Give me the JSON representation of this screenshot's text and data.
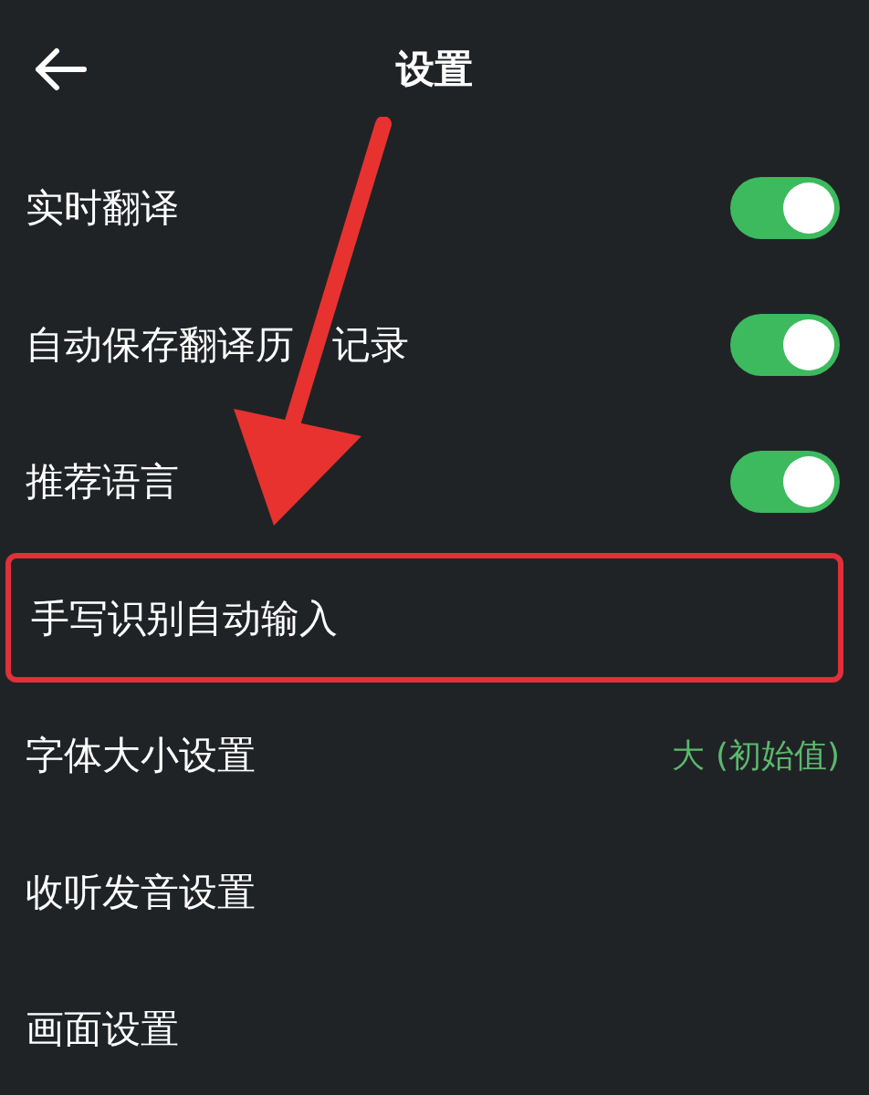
{
  "header": {
    "title": "设置"
  },
  "rows": [
    {
      "kind": "toggle",
      "label": "实时翻译",
      "on": true
    },
    {
      "kind": "toggle",
      "label": "自动保存翻译历",
      "label_2": "记录",
      "on": true
    },
    {
      "kind": "toggle",
      "label": "推荐语言",
      "on": true
    },
    {
      "kind": "plain",
      "label": "手写识别自动输入",
      "highlighted": true
    },
    {
      "kind": "value",
      "label": "字体大小设置",
      "value": "大 (初始值)"
    },
    {
      "kind": "plain",
      "label": "收听发音设置"
    },
    {
      "kind": "plain",
      "label": "画面设置"
    }
  ],
  "annotation": {
    "arrow": true
  }
}
